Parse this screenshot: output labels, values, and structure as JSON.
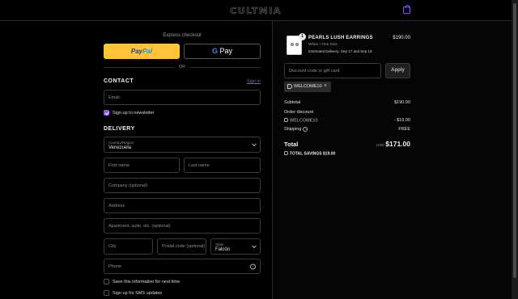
{
  "header": {
    "logo": "CULTMIA",
    "cart_icon": "shopping-bag-icon",
    "accent_color": "#8a58d6"
  },
  "express": {
    "title": "Express checkout",
    "paypal_a": "Pay",
    "paypal_b": "Pal",
    "gpay_g": "G",
    "gpay_text": " Pay",
    "or": "OR"
  },
  "contact": {
    "title": "CONTACT",
    "signin": "Sign in",
    "email_placeholder": "Email",
    "newsletter_label": "Sign up to newsletter",
    "newsletter_checked": true
  },
  "delivery": {
    "title": "DELIVERY",
    "country_label": "Country/Region",
    "country_value": "Venezuela",
    "first_name": "First name",
    "last_name": "Last name",
    "company": "Company (optional)",
    "address": "Address",
    "apartment": "Apartment, suite, etc. (optional)",
    "city": "City",
    "postal": "Postal code (optional)",
    "state_label": "State",
    "state_value": "Falcón",
    "phone": "Phone",
    "phone_help": "?",
    "save_info": "Save this information for next time",
    "sms": "Sign up for SMS updates"
  },
  "order": {
    "product": {
      "quantity": "1",
      "name": "PEARLS LUSH EARRINGS",
      "variant": "White / One Size",
      "delivery": "Estimated Delivery: Sep 17 and Sep 18",
      "price": "$190.00"
    },
    "discount_placeholder": "Discount code or gift card",
    "apply": "Apply",
    "applied_code": "WELCOME10",
    "remove": "×",
    "subtotal_label": "Subtotal",
    "subtotal_value": "$190.00",
    "order_discount_label": "Order discount",
    "discount_code": "WELCOME10",
    "discount_value": "- $19.00",
    "shipping_label": "Shipping",
    "shipping_help": "?",
    "shipping_value": "FREE",
    "total_label": "Total",
    "currency": "USD",
    "total_value": "$171.00",
    "savings_label": "TOTAL SAVINGS",
    "savings_value": "$19.00"
  }
}
